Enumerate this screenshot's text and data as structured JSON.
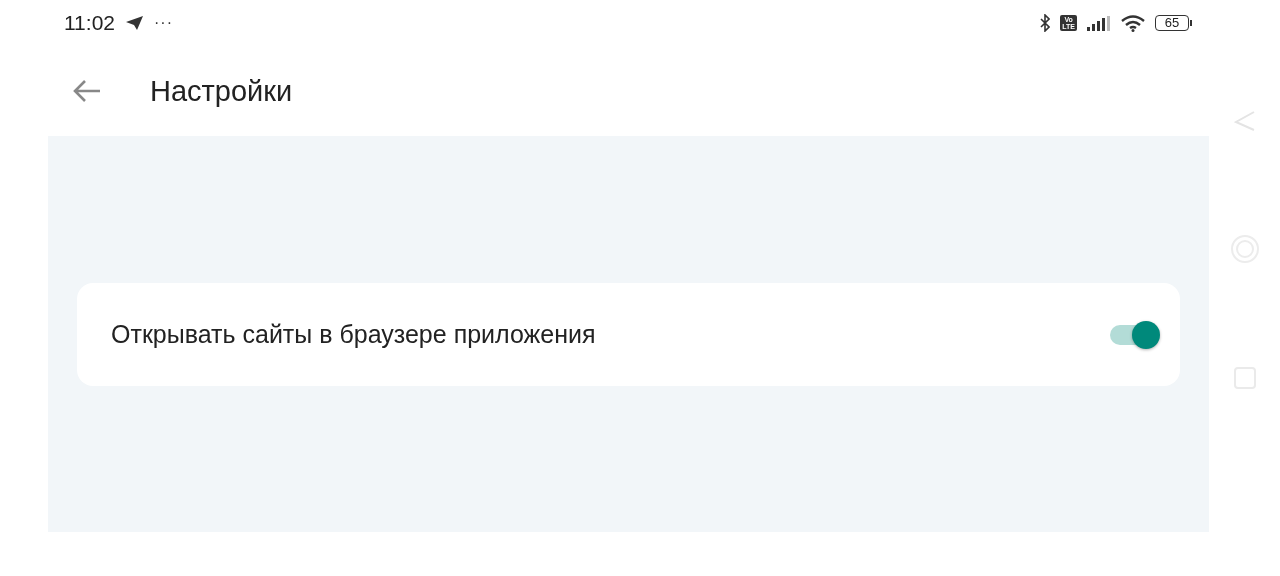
{
  "status_bar": {
    "time": "11:02",
    "overflow": "···",
    "network_badge": [
      "Vo",
      "LTE"
    ],
    "battery": "65"
  },
  "header": {
    "title": "Настройки"
  },
  "settings": [
    {
      "kind": "toggle",
      "label": "Открывать сайты в браузере приложения",
      "on": true
    }
  ]
}
